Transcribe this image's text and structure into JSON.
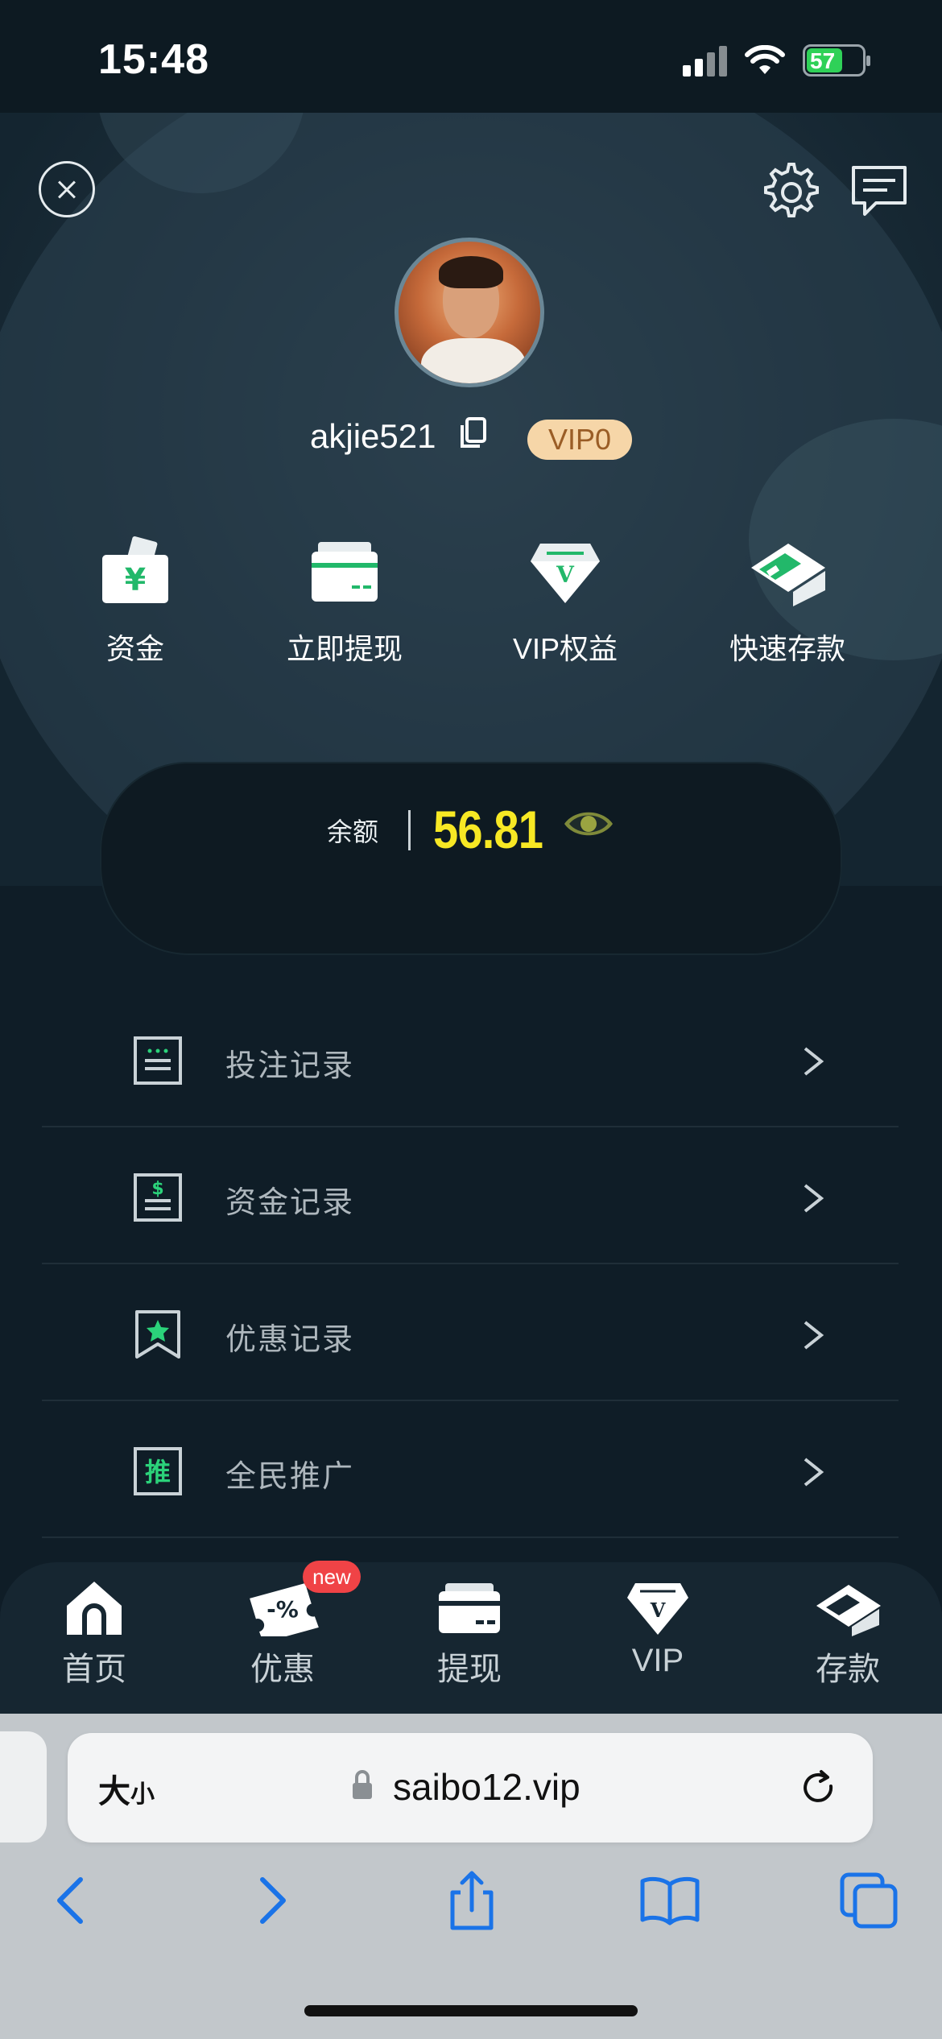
{
  "status_bar": {
    "time": "15:48",
    "battery": "57"
  },
  "profile": {
    "username": "akjie521",
    "vip_level": "VIP0"
  },
  "quick_actions": [
    {
      "label": "资金",
      "icon": "wallet-yuan-icon"
    },
    {
      "label": "立即提现",
      "icon": "card-withdraw-icon"
    },
    {
      "label": "VIP权益",
      "icon": "diamond-vip-icon"
    },
    {
      "label": "快速存款",
      "icon": "atm-deposit-icon"
    }
  ],
  "balance": {
    "label": "余额",
    "value": "56.81"
  },
  "menu": [
    {
      "label": "投注记录",
      "icon": "bet-record-icon"
    },
    {
      "label": "资金记录",
      "icon": "fund-record-icon"
    },
    {
      "label": "优惠记录",
      "icon": "bookmark-star-icon"
    },
    {
      "label": "全民推广",
      "icon": "promote-icon",
      "icon_text": "推"
    }
  ],
  "tabbar": [
    {
      "label": "首页",
      "icon": "home-icon"
    },
    {
      "label": "优惠",
      "icon": "coupon-icon",
      "badge": "new"
    },
    {
      "label": "提现",
      "icon": "card-icon"
    },
    {
      "label": "VIP",
      "icon": "diamond-icon"
    },
    {
      "label": "存款",
      "icon": "atm-icon"
    }
  ],
  "browser": {
    "text_size_label": "大",
    "text_size_small": "小",
    "url": "saibo12.vip"
  },
  "colors": {
    "accent_green": "#2bd27a",
    "balance_yellow": "#f7e824",
    "vip_badge": "#f6d6a8"
  }
}
